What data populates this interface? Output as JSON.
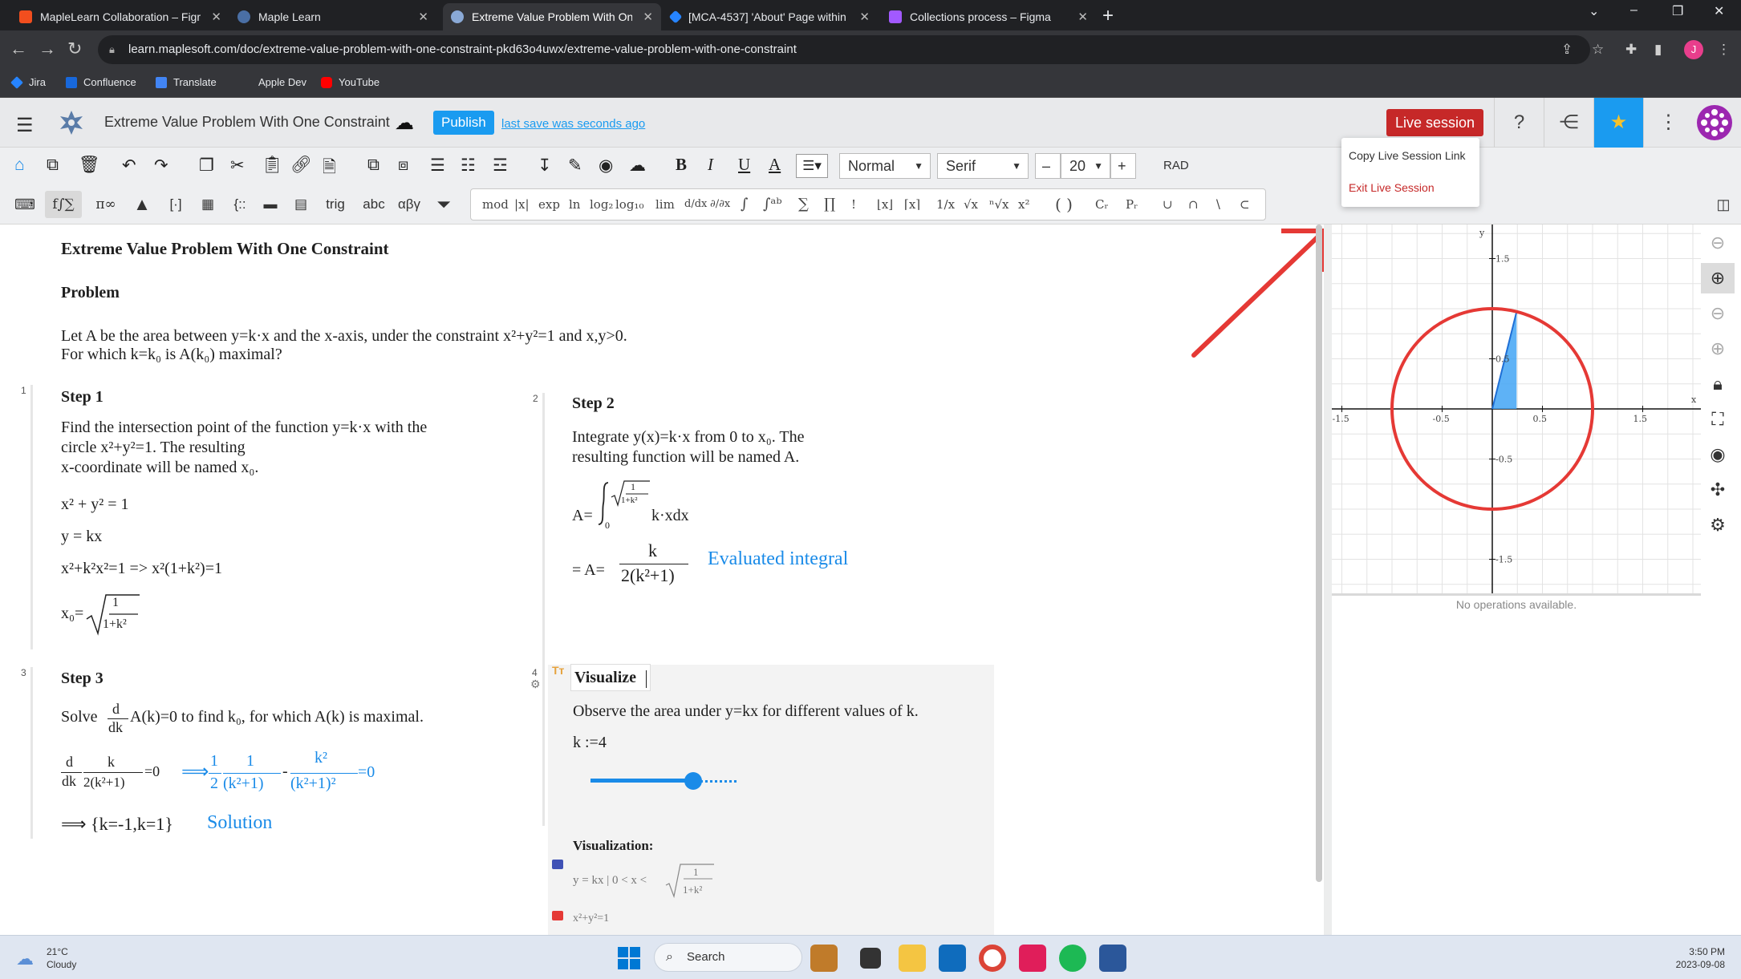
{
  "browser": {
    "tabs": [
      {
        "label": "MapleLearn Collaboration – Figma",
        "active": false
      },
      {
        "label": "Maple Learn",
        "active": false
      },
      {
        "label": "Extreme Value Problem With One Constraint",
        "active": true
      },
      {
        "label": "[MCA-4537] 'About' Page within ...",
        "active": false
      },
      {
        "label": "Collections process – Figma",
        "active": false
      }
    ],
    "url": "learn.maplesoft.com/doc/extreme-value-problem-with-one-constraint-pkd63o4uwx/extreme-value-problem-with-one-constraint",
    "profile_initial": "J",
    "bookmarks": [
      "Jira",
      "Confluence",
      "Translate",
      "Apple Dev",
      "YouTube"
    ]
  },
  "app": {
    "doc_title": "Extreme Value Problem With One Constraint",
    "publish_label": "Publish",
    "last_save": "last save was seconds ago",
    "live_session_label": "Live session",
    "popup": {
      "copy_link": "Copy Live Session Link",
      "exit": "Exit Live Session"
    }
  },
  "toolbar": {
    "style_select": "Normal",
    "font_select": "Serif",
    "font_size": "20",
    "angle_mode": "RAD",
    "tb2_buttons": [
      "f∫∑",
      "π∞",
      "trig",
      "abc",
      "αβγ"
    ],
    "math_palette": [
      "mod",
      "|x|",
      "exp",
      "ln",
      "log₂",
      "log₁₀",
      "lim",
      "∫",
      "∑",
      "∏",
      "!",
      "1/x",
      "x²"
    ]
  },
  "document": {
    "title": "Extreme Value Problem With One Constraint",
    "problem_heading": "Problem",
    "problem_line1": "Let A be the area between y=k·x and the x-axis, under the constraint x²+y²=1 and x,y>0.",
    "problem_line2": "For which k=k₀ is A(k₀) maximal?",
    "step1": {
      "num": "1",
      "heading": "Step 1",
      "text1": "Find the intersection point of the function y=k·x with the",
      "text2": "circle x²+y²=1. The resulting",
      "text3": "x-coordinate will be named x₀.",
      "eq1": "x² + y² = 1",
      "eq2": "y = kx",
      "eq3": "x²+k²x²=1  =>  x²(1+k²)=1",
      "eq4_lhs": "x₀=",
      "eq4_num": "1",
      "eq4_den": "1+k²"
    },
    "step2": {
      "num": "2",
      "heading": "Step 2",
      "text1": "Integrate y(x)=k·x from 0 to x₀. The",
      "text2": "resulting function will be named A.",
      "eq1": "A=",
      "integrand": "k·xdx",
      "lower": "0",
      "upper_num": "1",
      "upper_den": "1+k²",
      "eq2_lhs": "= A=",
      "eq2_num": "k",
      "eq2_den": "2(k²+1)",
      "eq2_label": "Evaluated integral"
    },
    "step3": {
      "num": "3",
      "heading": "Step 3",
      "text_pre": "Solve",
      "text_post": "A(k)=0 to find k₀, for which A(k) is maximal.",
      "d": "d",
      "dk": "dk",
      "frac_num": "k",
      "frac_den": "2(k²+1)",
      "eq_zero": "=0",
      "implies": "⟹",
      "res_half_num": "1",
      "res_half_den": "2",
      "res_t1_num": "1",
      "res_t1_den": "(k²+1)",
      "res_t2_num": "k²",
      "res_t2_den": "(k²+1)²",
      "minus": "-",
      "solution_set": "⟹ {k=-1,k=1}",
      "solution_label": "Solution"
    },
    "step4": {
      "num": "4",
      "heading": "Visualize",
      "text": "Observe the area under y=kx for different values of k.",
      "k_assign": "k :=4",
      "k_value": 4,
      "viz_label": "Visualization:",
      "expr1": "y = kx | 0 < x <",
      "expr1_num": "1",
      "expr1_den": "1+k²",
      "expr2": "x²+y²=1"
    }
  },
  "graph": {
    "x_label": "x",
    "y_label": "y",
    "x_ticks": [
      "-1.5",
      "-0.5",
      "0.5",
      "1.5"
    ],
    "y_ticks": [
      "1.5",
      "0.5",
      "-0.5",
      "-1.5"
    ],
    "no_ops": "No operations available.",
    "circle_color": "#e53935",
    "area_color": "#42a5f5",
    "k": 4
  },
  "taskbar": {
    "temp": "21°C",
    "weather": "Cloudy",
    "search": "Search",
    "time": "3:50 PM",
    "date": "2023-09-08"
  }
}
